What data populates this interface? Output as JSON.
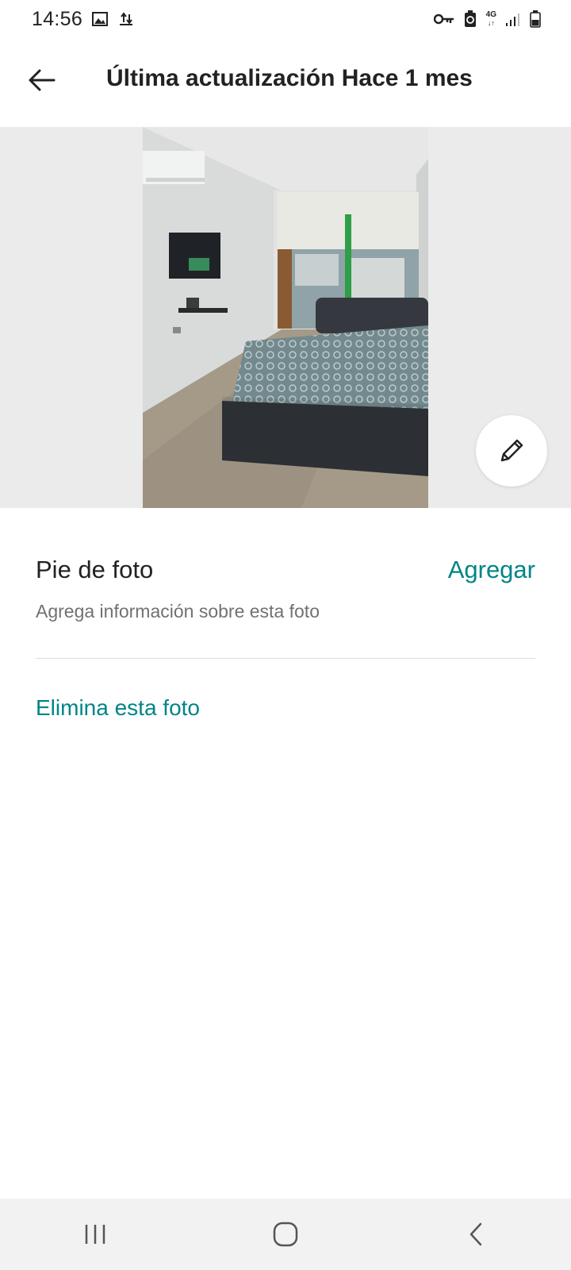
{
  "status_bar": {
    "time": "14:56",
    "left_icons": [
      "gallery-icon",
      "upload-icon"
    ],
    "right_icons": [
      "key-icon",
      "battery-saver-icon",
      "network-4g-icon",
      "signal-icon",
      "battery-icon"
    ],
    "network_label": "4G"
  },
  "header": {
    "title": "Última actualización Hace 1 mes"
  },
  "photo": {
    "edit_icon": "pencil-icon"
  },
  "caption": {
    "title": "Pie de foto",
    "add_label": "Agregar",
    "subtitle": "Agrega información sobre esta foto"
  },
  "actions": {
    "delete_label": "Elimina esta foto"
  },
  "colors": {
    "accent": "#008489",
    "photo_background": "#ebebeb",
    "nav_background": "#f2f2f2"
  },
  "nav_bar": {
    "buttons": [
      "recent-apps-icon",
      "home-icon",
      "back-icon"
    ]
  }
}
